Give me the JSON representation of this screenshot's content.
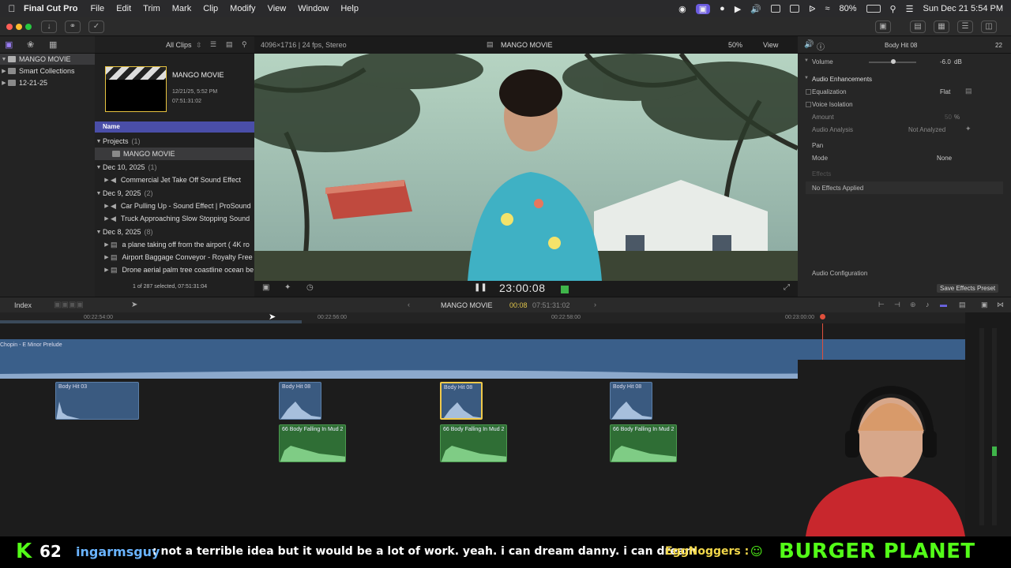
{
  "menubar": {
    "app_name": "Final Cut Pro",
    "items": [
      "File",
      "Edit",
      "Trim",
      "Mark",
      "Clip",
      "Modify",
      "View",
      "Window",
      "Help"
    ],
    "battery": "80%",
    "datetime": "Sun Dec 21  5:54 PM"
  },
  "libraries": {
    "items": [
      {
        "label": "MANGO MOVIE",
        "selected": true
      },
      {
        "label": "Smart Collections",
        "selected": false
      },
      {
        "label": "12-21-25",
        "selected": false
      }
    ]
  },
  "browser": {
    "filter": "All Clips",
    "project": {
      "title": "MANGO MOVIE",
      "date": "12/21/25, 5:52 PM",
      "duration": "07:51:31:02"
    },
    "column_name": "Name",
    "groups": [
      {
        "label": "Projects",
        "count": "(1)",
        "items": [
          "MANGO MOVIE"
        ]
      },
      {
        "label": "Dec 10, 2025",
        "count": "(1)",
        "items": [
          "Commercial Jet Take Off Sound Effect"
        ]
      },
      {
        "label": "Dec 9, 2025",
        "count": "(2)",
        "items": [
          "Car Pulling Up - Sound Effect  |  ProSound",
          "Truck Approaching Slow Stopping Sound"
        ]
      },
      {
        "label": "Dec 8, 2025",
        "count": "(8)",
        "items": [
          "a plane taking off from the airport ( 4K ro",
          "Airport Baggage Conveyor - Royalty Free",
          "Drone aerial palm tree coastline ocean be"
        ]
      }
    ],
    "selection_status": "1 of 287 selected, 07:51:31:04"
  },
  "viewer": {
    "format": "4096×1716 | 24 fps, Stereo",
    "title": "MANGO MOVIE",
    "zoom": "50%",
    "view_label": "View",
    "timecode": "23:00:08"
  },
  "inspector": {
    "clip_name": "Body Hit 08",
    "clip_count": "22",
    "volume_label": "Volume",
    "volume_value": "-6.0",
    "volume_unit": "dB",
    "audio_enhancements": "Audio Enhancements",
    "equalization_label": "Equalization",
    "equalization_value": "Flat",
    "voice_isolation": "Voice Isolation",
    "amount_label": "Amount",
    "amount_value": "50",
    "amount_unit": "%",
    "audio_analysis_label": "Audio Analysis",
    "audio_analysis_value": "Not Analyzed",
    "pan_label": "Pan",
    "mode_label": "Mode",
    "mode_value": "None",
    "effects_label": "Effects",
    "no_effects": "No Effects Applied",
    "audio_config": "Audio Configuration",
    "save_preset": "Save Effects Preset"
  },
  "timeline": {
    "index_label": "Index",
    "project": "MANGO MOVIE",
    "timecode_current": "00:08",
    "timecode_total": "07:51:31:02",
    "ruler": [
      "00:22:54:00",
      "00:22:56:00",
      "00:22:58:00",
      "00:23:00:00"
    ],
    "music_clip": "Chopin - E Minor Prelude",
    "blue_clips": [
      "Body Hit 03",
      "Body Hit 08",
      "Body Hit 08",
      "Body Hit 08"
    ],
    "green_clips": [
      "66 Body Falling In Mud 2",
      "66 Body Falling In Mud 2",
      "66 Body Falling In Mud 2"
    ]
  },
  "ticker": {
    "logo_letter": "K",
    "count": "62",
    "username": "ingarmsguy",
    "message": ": not a terrible idea but it would be a lot of work. yeah. i can dream danny. i can dream",
    "username2": "EggNoggers :",
    "brand": "BURGER PLANET"
  }
}
